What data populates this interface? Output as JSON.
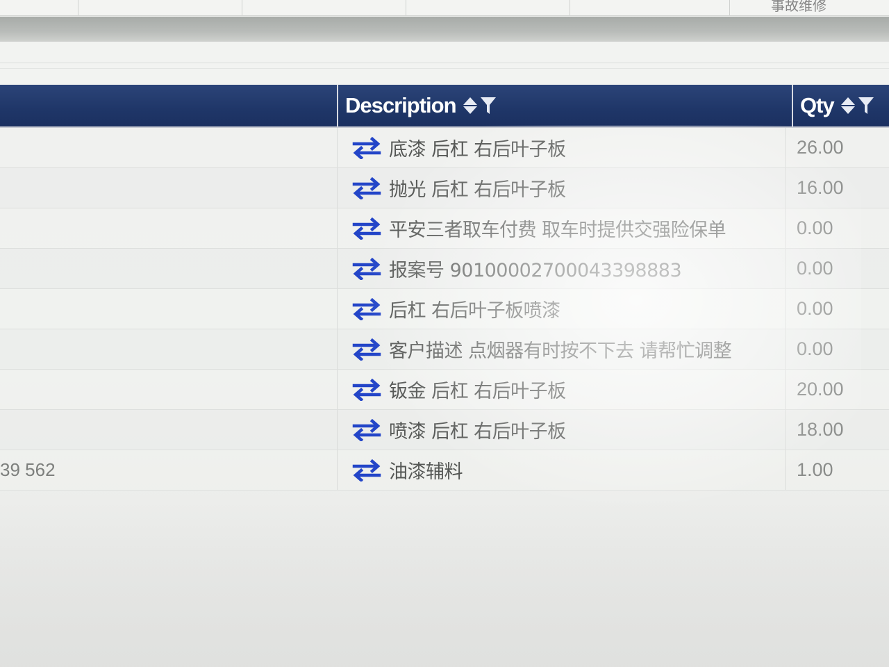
{
  "top_strip": {
    "partial_text": "事故维修"
  },
  "table": {
    "columns": {
      "description": "Description",
      "qty": "Qty"
    },
    "rows": [
      {
        "left": "",
        "description": "底漆 后杠 右后叶子板",
        "qty": "26.00"
      },
      {
        "left": "",
        "description": "抛光 后杠 右后叶子板",
        "qty": "16.00"
      },
      {
        "left": "",
        "description": "平安三者取车付费 取车时提供交强险保单",
        "qty": "0.00"
      },
      {
        "left": "",
        "description": "报案号 90100002700043398883",
        "qty": "0.00"
      },
      {
        "left": "",
        "description": "后杠 右后叶子板喷漆",
        "qty": "0.00"
      },
      {
        "left": "",
        "description": "客户描述 点烟器有时按不下去 请帮忙调整",
        "qty": "0.00"
      },
      {
        "left": "",
        "description": "钣金 后杠 右后叶子板",
        "qty": "20.00"
      },
      {
        "left": "",
        "description": "喷漆 后杠 右后叶子板",
        "qty": "18.00"
      },
      {
        "left": "39 562",
        "description": "油漆辅料",
        "qty": "1.00"
      }
    ]
  },
  "icons": {
    "row_icon": "swap-arrows-icon",
    "sort": "sort-icon",
    "filter": "filter-icon"
  },
  "colors": {
    "header_bg": "#1f3668",
    "icon_blue": "#2345c8"
  }
}
